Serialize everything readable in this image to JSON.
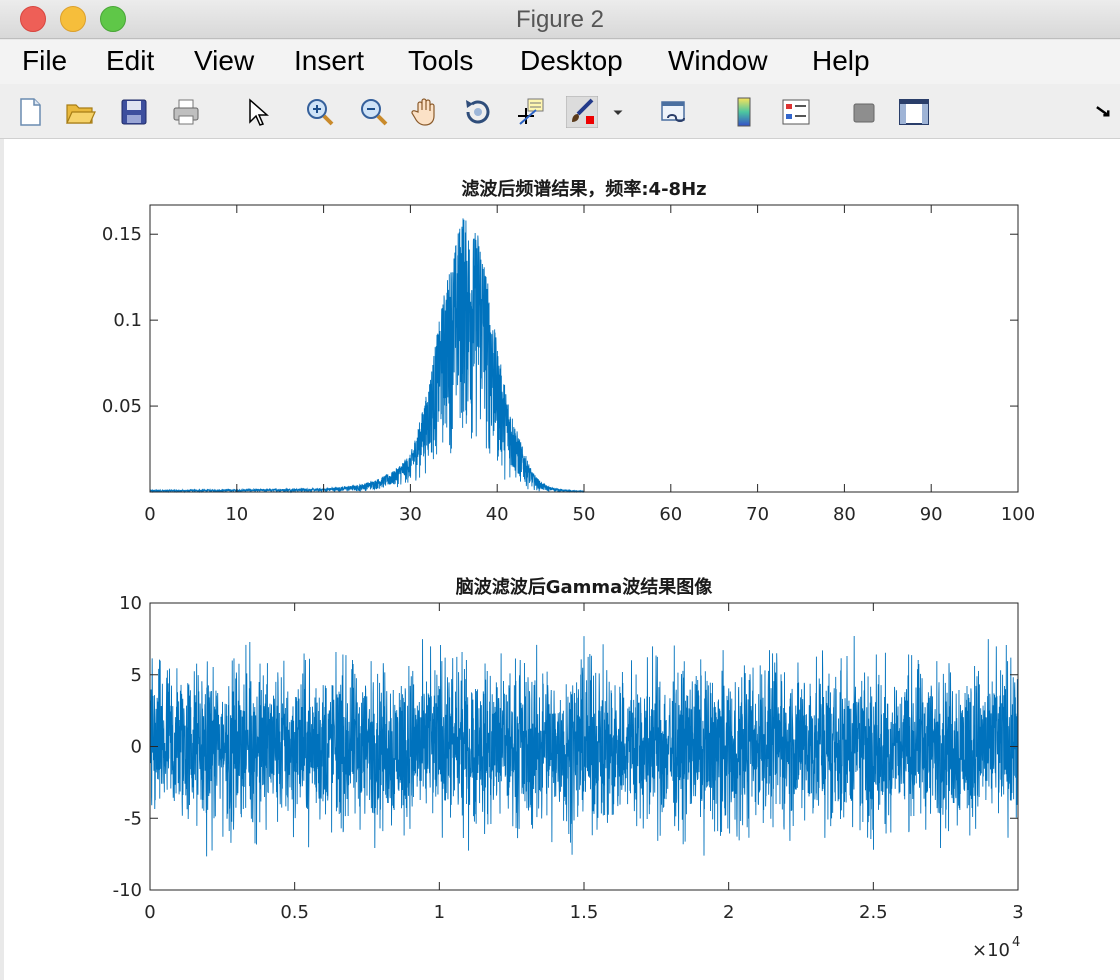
{
  "window": {
    "title": "Figure 2"
  },
  "menu": {
    "items": [
      "File",
      "Edit",
      "View",
      "Insert",
      "Tools",
      "Desktop",
      "Window",
      "Help"
    ]
  },
  "toolbar": {
    "icons": [
      "new-figure-icon",
      "open-file-icon",
      "save-icon",
      "print-icon",
      "pointer-icon",
      "zoom-in-icon",
      "zoom-out-icon",
      "pan-hand-icon",
      "rotate-3d-icon",
      "data-cursor-icon",
      "brush-icon",
      "brush-dropdown-icon",
      "link-plot-icon",
      "colorbar-icon",
      "legend-icon",
      "hide-plot-tools-icon",
      "show-plot-tools-icon",
      "dock-arrow-icon"
    ]
  },
  "colors": {
    "line": "#0072BD",
    "axes": "#262626",
    "background": "#ffffff"
  },
  "chart_data": [
    {
      "type": "line",
      "title": "滤波后频谱结果，频率:4-8Hz",
      "xlabel": "",
      "ylabel": "",
      "xlim": [
        0,
        100
      ],
      "ylim": [
        0,
        0.167
      ],
      "xticks": [
        0,
        10,
        20,
        30,
        40,
        50,
        60,
        70,
        80,
        90,
        100
      ],
      "xtick_labels": [
        "0",
        "10",
        "20",
        "30",
        "40",
        "50",
        "60",
        "70",
        "80",
        "90",
        "100"
      ],
      "yticks": [
        0.05,
        0.1,
        0.15
      ],
      "ytick_labels": [
        "0.05",
        "0.1",
        "0.15"
      ],
      "series_description": "dense spectrum, near 0 outside 25-45, peak ≈0.16 near x≈36",
      "envelope": {
        "x": [
          0,
          20,
          24,
          26,
          28,
          30,
          31,
          32,
          33,
          34,
          35,
          36,
          37,
          38,
          39,
          40,
          41,
          42,
          43,
          44,
          45,
          46,
          48,
          50
        ],
        "upper": [
          0.001,
          0.002,
          0.004,
          0.007,
          0.012,
          0.022,
          0.04,
          0.06,
          0.09,
          0.12,
          0.14,
          0.165,
          0.15,
          0.155,
          0.12,
          0.085,
          0.06,
          0.04,
          0.025,
          0.012,
          0.006,
          0.003,
          0.001,
          0.0005
        ],
        "lower": [
          0,
          0,
          0,
          0.001,
          0.002,
          0.004,
          0.006,
          0.01,
          0.015,
          0.018,
          0.02,
          0.022,
          0.02,
          0.016,
          0.012,
          0.008,
          0.005,
          0.003,
          0.002,
          0.001,
          0,
          0,
          0,
          0
        ]
      }
    },
    {
      "type": "line",
      "title": "脑波滤波后Gamma波结果图像",
      "xlabel": "",
      "ylabel": "",
      "xlim": [
        0,
        30000
      ],
      "ylim": [
        -10,
        10
      ],
      "xticks": [
        0,
        5000,
        10000,
        15000,
        20000,
        25000,
        30000
      ],
      "xtick_labels": [
        "0",
        "0.5",
        "1",
        "1.5",
        "2",
        "2.5",
        "3"
      ],
      "yticks": [
        -10,
        -5,
        0,
        5,
        10
      ],
      "ytick_labels": [
        "-10",
        "-5",
        "0",
        "5",
        "10"
      ],
      "x_exponent_base": "×10",
      "x_exponent_power": "4",
      "series_description": "dense noise-like signal, band ≈ ±3, spikes to about ±7.5",
      "amplitude": {
        "band": 3,
        "spike_max": 7.7,
        "spike_min": -8.6
      }
    }
  ]
}
